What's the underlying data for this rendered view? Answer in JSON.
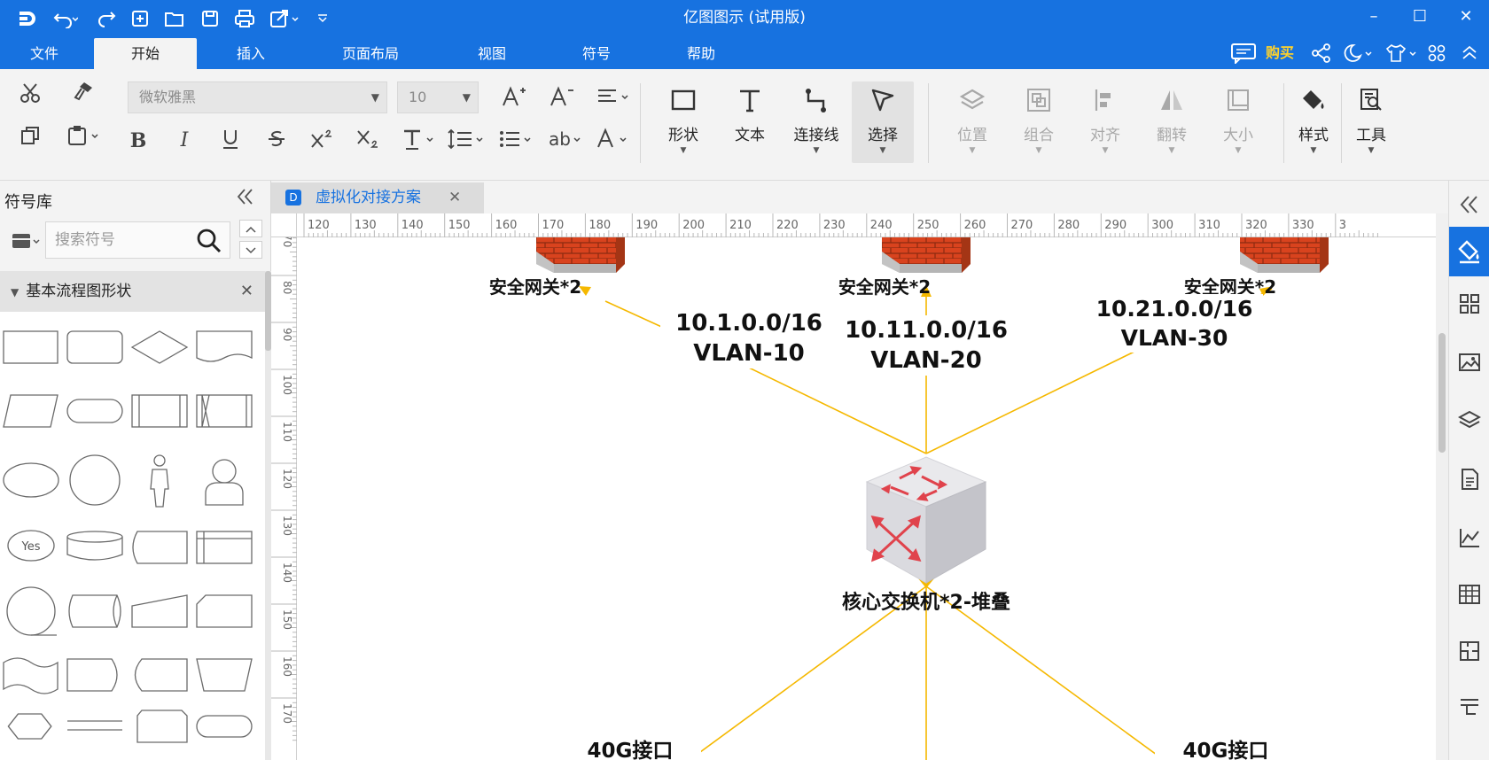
{
  "app": {
    "title": "亿图图示 (试用版)"
  },
  "titlebar": {
    "quick_access": [
      "logo-icon",
      "undo-icon",
      "redo-icon",
      "new-icon",
      "open-icon",
      "save-icon",
      "print-icon",
      "export-icon",
      "customize-icon"
    ],
    "window_controls": [
      "minimize-icon",
      "maximize-icon",
      "close-icon"
    ]
  },
  "menubar": {
    "items": [
      "文件",
      "开始",
      "插入",
      "页面布局",
      "视图",
      "符号",
      "帮助"
    ],
    "active": "开始",
    "buy_label": "购买"
  },
  "ribbon": {
    "font_name": "微软雅黑",
    "font_size": "10",
    "tools": [
      {
        "label": "形状",
        "enabled": true
      },
      {
        "label": "文本",
        "enabled": true
      },
      {
        "label": "连接线",
        "enabled": true
      },
      {
        "label": "选择",
        "enabled": true
      },
      {
        "label": "位置",
        "enabled": false
      },
      {
        "label": "组合",
        "enabled": false
      },
      {
        "label": "对齐",
        "enabled": false
      },
      {
        "label": "翻转",
        "enabled": false
      },
      {
        "label": "大小",
        "enabled": false
      },
      {
        "label": "样式",
        "enabled": true
      },
      {
        "label": "工具",
        "enabled": true
      }
    ]
  },
  "library": {
    "title": "符号库",
    "search_placeholder": "搜索符号",
    "section_title": "基本流程图形状",
    "yes_label": "Yes"
  },
  "document": {
    "tab_title": "虚拟化对接方案"
  },
  "ruler": {
    "top_ticks": [
      "120",
      "130",
      "140",
      "150",
      "160",
      "170",
      "180",
      "190",
      "200",
      "210",
      "220",
      "230",
      "240",
      "250",
      "260",
      "270",
      "280",
      "290",
      "300",
      "310",
      "320",
      "330",
      "3"
    ],
    "left_ticks": [
      "70",
      "80",
      "90",
      "100",
      "110",
      "120",
      "130",
      "140",
      "150",
      "160",
      "170"
    ]
  },
  "diagram": {
    "gateway_labels": [
      "安全网关*2",
      "安全网关*2",
      "安全网关*2"
    ],
    "vlan_labels": [
      {
        "line1": "10.1.0.0/16",
        "line2": "VLAN-10"
      },
      {
        "line1": "10.11.0.0/16",
        "line2": "VLAN-20"
      },
      {
        "line1": "10.21.0.0/16",
        "line2": "VLAN-30"
      }
    ],
    "core_switch_label": "核心交换机*2-堆叠",
    "interface_labels": [
      "40G接口",
      "40G接口"
    ],
    "line_color": "#f5b800",
    "brick_color": "#d9431e"
  },
  "rightpanel": {
    "icons": [
      "collapse-right-icon",
      "fill-style-icon",
      "grid-icon",
      "image-icon",
      "layers-icon",
      "page-icon",
      "chart-icon",
      "table-icon",
      "floorplan-icon",
      "more-icon"
    ]
  }
}
